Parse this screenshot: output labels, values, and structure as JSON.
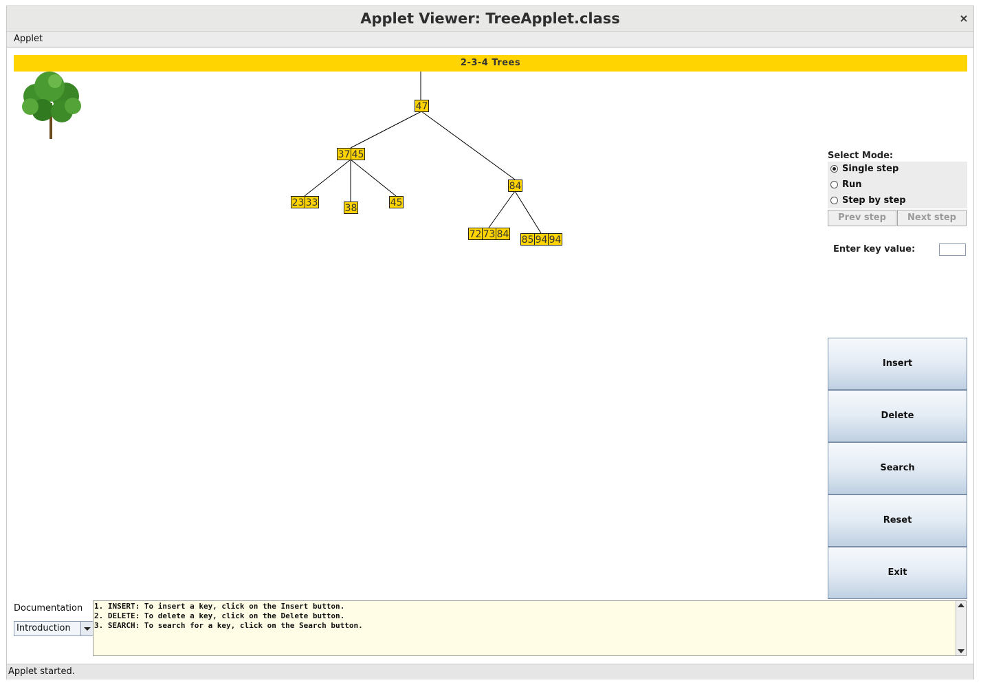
{
  "window": {
    "title": "Applet Viewer: TreeApplet.class",
    "close_glyph": "×",
    "menu": [
      "Applet"
    ]
  },
  "banner": {
    "title": "2-3-4  Trees",
    "color": "#ffd400"
  },
  "logo": {
    "icon": "tree-icon"
  },
  "tree": {
    "nodes": [
      {
        "id": "root",
        "keys": [
          "47"
        ]
      },
      {
        "id": "left",
        "keys": [
          "37",
          "45"
        ]
      },
      {
        "id": "right",
        "keys": [
          "84"
        ]
      },
      {
        "id": "ll",
        "keys": [
          "23",
          "33"
        ]
      },
      {
        "id": "lm",
        "keys": [
          "38"
        ]
      },
      {
        "id": "lr",
        "keys": [
          "45"
        ]
      },
      {
        "id": "rl",
        "keys": [
          "72",
          "73",
          "84"
        ]
      },
      {
        "id": "rr",
        "keys": [
          "85",
          "94",
          "94"
        ]
      }
    ],
    "edges": [
      [
        "root",
        "left"
      ],
      [
        "root",
        "right"
      ],
      [
        "left",
        "ll"
      ],
      [
        "left",
        "lm"
      ],
      [
        "left",
        "lr"
      ],
      [
        "right",
        "rl"
      ],
      [
        "right",
        "rr"
      ]
    ],
    "node_color": "#ffd400"
  },
  "mode": {
    "label": "Select Mode:",
    "options": [
      {
        "label": "Single step",
        "selected": true
      },
      {
        "label": "Run",
        "selected": false
      },
      {
        "label": "Step by step",
        "selected": false
      }
    ],
    "prev_step": "Prev step",
    "next_step": "Next step"
  },
  "key_entry": {
    "label": "Enter key value:",
    "value": ""
  },
  "actions": [
    "Insert",
    "Delete",
    "Search",
    "Reset",
    "Exit"
  ],
  "documentation": {
    "label": "Documentation",
    "selected": "Introduction",
    "lines": [
      "1. INSERT: To insert a key, click on the Insert button.",
      "2. DELETE: To delete a key, click on the Delete button.",
      "3. SEARCH: To search for a key, click on the Search button."
    ]
  },
  "status": "Applet started."
}
